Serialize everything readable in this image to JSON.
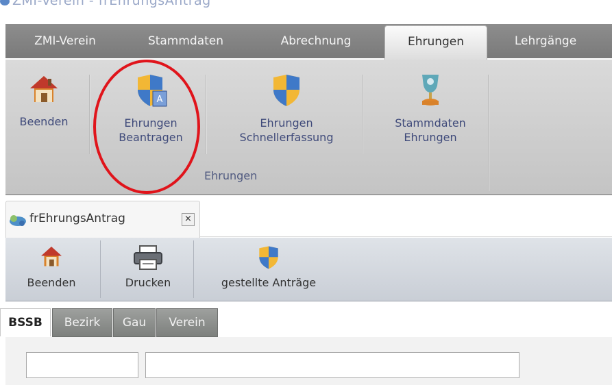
{
  "window": {
    "title": "ZMI-Verein - frEhrungsAntrag"
  },
  "ribbon": {
    "tabs": [
      {
        "label": "ZMI-Verein"
      },
      {
        "label": "Stammdaten"
      },
      {
        "label": "Abrechnung"
      },
      {
        "label": "Ehrungen",
        "active": true
      },
      {
        "label": "Lehrgänge"
      }
    ],
    "buttons": {
      "beenden": {
        "line1": "Beenden",
        "icon": "house-icon"
      },
      "beantragen": {
        "line1": "Ehrungen",
        "line2": "Beantragen",
        "icon": "shield-document-icon"
      },
      "schnellerfassung": {
        "line1": "Ehrungen",
        "line2": "Schnellerfassung",
        "icon": "shield-icon"
      },
      "stammdaten": {
        "line1": "Stammdaten",
        "line2": "Ehrungen",
        "icon": "trophy-icon"
      }
    },
    "group_label": "Ehrungen"
  },
  "document_tab": {
    "label": "frEhrungsAntrag",
    "close_symbol": "×"
  },
  "toolbar": {
    "beenden": "Beenden",
    "drucken": "Drucken",
    "antraege": "gestellte Anträge"
  },
  "inner_tabs": [
    {
      "label": "BSSB",
      "active": true
    },
    {
      "label": "Bezirk"
    },
    {
      "label": "Gau"
    },
    {
      "label": "Verein"
    }
  ],
  "form": {
    "field1_value": "",
    "field2_value": ""
  },
  "colors": {
    "annotation": "#e0141b",
    "ribbon_tab_bg": "#868686",
    "ribbon_body": "#d0d0d0"
  }
}
